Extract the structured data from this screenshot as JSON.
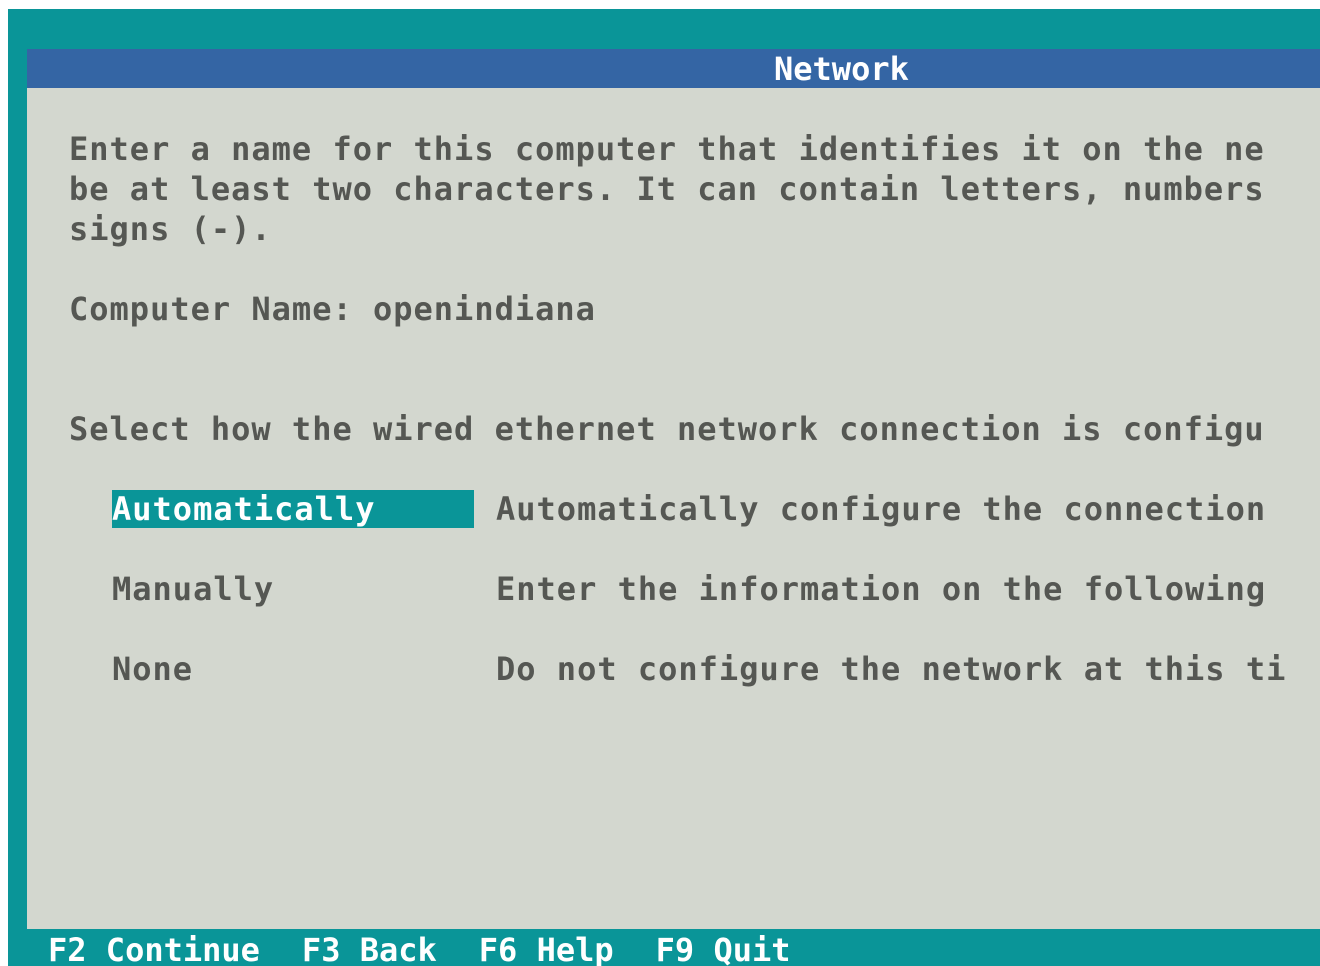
{
  "window": {
    "title": "Network"
  },
  "intro": {
    "line1": "Enter a name for this computer that identifies it on the ne",
    "line2": "be at least two characters. It can contain letters, numbers",
    "line3": "signs (-)."
  },
  "computer_name": {
    "label": "Computer Name:",
    "value": "openindiana"
  },
  "network": {
    "prompt": "Select how the wired ethernet network connection is configu",
    "options": [
      {
        "label": "Automatically",
        "description": "Automatically configure the connection",
        "selected": true
      },
      {
        "label": "Manually",
        "description": "Enter the information on the following",
        "selected": false
      },
      {
        "label": "None",
        "description": "Do not configure the network at this ti",
        "selected": false
      }
    ]
  },
  "footer": {
    "keys": [
      "F2 Continue",
      "F3 Back",
      "F6 Help",
      "F9 Quit"
    ]
  },
  "colors": {
    "background": "#0a9598",
    "title_bar": "#3465a4",
    "panel": "#d3d7cf",
    "text": "#555753",
    "highlight": "#0a9598"
  }
}
